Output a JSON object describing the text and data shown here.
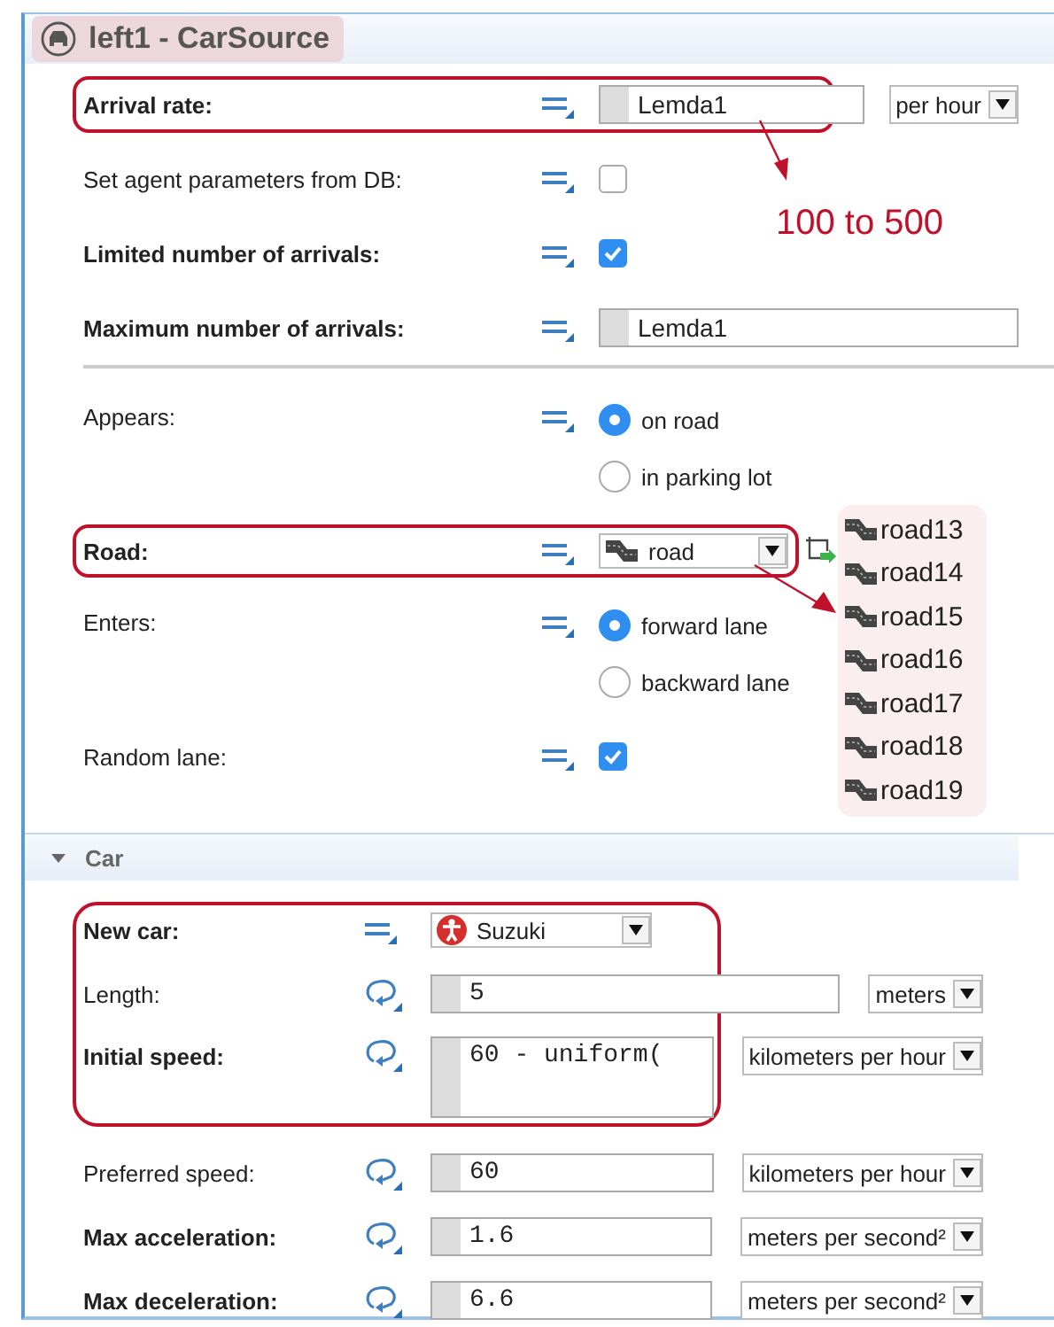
{
  "title": "left1 - CarSource",
  "sections": [
    {
      "rows": [
        {
          "kind": "expression",
          "label": "Arrival rate:",
          "emphasized": true,
          "dynamic": false,
          "value": "Lemda1",
          "unit": "per hour",
          "highlighted": true
        },
        {
          "kind": "checkbox",
          "label": "Set agent parameters from DB:",
          "emphasized": false,
          "dynamic": false,
          "checked": false,
          "highlighted": false
        },
        {
          "kind": "checkbox",
          "label": "Limited number of arrivals:",
          "emphasized": true,
          "dynamic": false,
          "checked": true,
          "highlighted": false
        },
        {
          "kind": "expression",
          "label": "Maximum number of arrivals:",
          "emphasized": true,
          "dynamic": false,
          "value": "Lemda1",
          "highlighted": false
        }
      ]
    },
    {
      "rows": [
        {
          "kind": "radio",
          "label": "Appears:",
          "emphasized": false,
          "dynamic": false,
          "options": [
            {
              "label": "on road",
              "selected": true
            },
            {
              "label": "in parking lot",
              "selected": false
            }
          ],
          "highlighted": false
        },
        {
          "kind": "road_select",
          "label": "Road:",
          "emphasized": true,
          "dynamic": false,
          "value": "road",
          "highlighted": true
        },
        {
          "kind": "radio",
          "label": "Enters:",
          "emphasized": false,
          "dynamic": false,
          "options": [
            {
              "label": "forward lane",
              "selected": true
            },
            {
              "label": "backward lane",
              "selected": false
            }
          ],
          "highlighted": false
        },
        {
          "kind": "checkbox",
          "label": "Random lane:",
          "emphasized": false,
          "dynamic": false,
          "checked": true,
          "highlighted": false
        }
      ]
    },
    {
      "title": "Car",
      "expanded": true,
      "rows": [
        {
          "kind": "agent_select",
          "label": "New car:",
          "emphasized": true,
          "dynamic": false,
          "value": "Suzuki",
          "highlighted": true
        },
        {
          "kind": "expression",
          "label": "Length:",
          "emphasized": false,
          "dynamic": true,
          "value": "5",
          "unit": "meters",
          "highlighted": true
        },
        {
          "kind": "expression",
          "label": "Initial speed:",
          "emphasized": true,
          "dynamic": true,
          "value": "60 - uniform(",
          "unit": "kilometers per hour",
          "multiline": true,
          "highlighted": true
        },
        {
          "kind": "expression",
          "label": "Preferred speed:",
          "emphasized": false,
          "dynamic": true,
          "value": "60",
          "unit": "kilometers per hour",
          "highlighted": false
        },
        {
          "kind": "expression",
          "label": "Max acceleration:",
          "emphasized": true,
          "dynamic": true,
          "value": "1.6",
          "unit": "meters per second²",
          "highlighted": false
        },
        {
          "kind": "expression",
          "label": "Max deceleration:",
          "emphasized": true,
          "dynamic": true,
          "value": "6.6",
          "unit": "meters per second²",
          "highlighted": false
        }
      ]
    }
  ],
  "annotation": {
    "note": "100 to 500",
    "road_options": [
      "road13",
      "road14",
      "road15",
      "road16",
      "road17",
      "road18",
      "road19"
    ]
  }
}
